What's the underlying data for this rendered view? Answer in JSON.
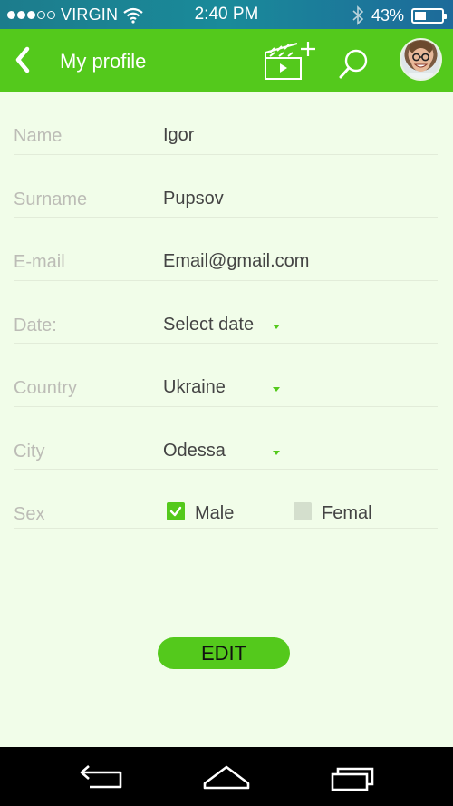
{
  "status_bar": {
    "carrier": "VIRGIN",
    "time": "2:40 PM",
    "battery": "43%",
    "battery_level": 0.43,
    "signal_bars_filled": 3,
    "signal_bars_total": 5
  },
  "header": {
    "title": "My profile"
  },
  "form": {
    "name": {
      "label": "Name",
      "value": "Igor"
    },
    "surname": {
      "label": "Surname",
      "value": "Pupsov"
    },
    "email": {
      "label": "E-mail",
      "value": "Email@gmail.com"
    },
    "date": {
      "label": "Date:",
      "value": "Select date"
    },
    "country": {
      "label": "Country",
      "value": "Ukraine"
    },
    "city": {
      "label": "City",
      "value": "Odessa"
    },
    "sex": {
      "label": "Sex",
      "male": "Male",
      "female": "Femal",
      "male_checked": true,
      "female_checked": false
    }
  },
  "edit_button": "EDIT",
  "colors": {
    "accent": "#54c91c",
    "background": "#f1fde9",
    "label": "#bcbcb6",
    "value": "#444444",
    "nav_bar": "#000000"
  }
}
